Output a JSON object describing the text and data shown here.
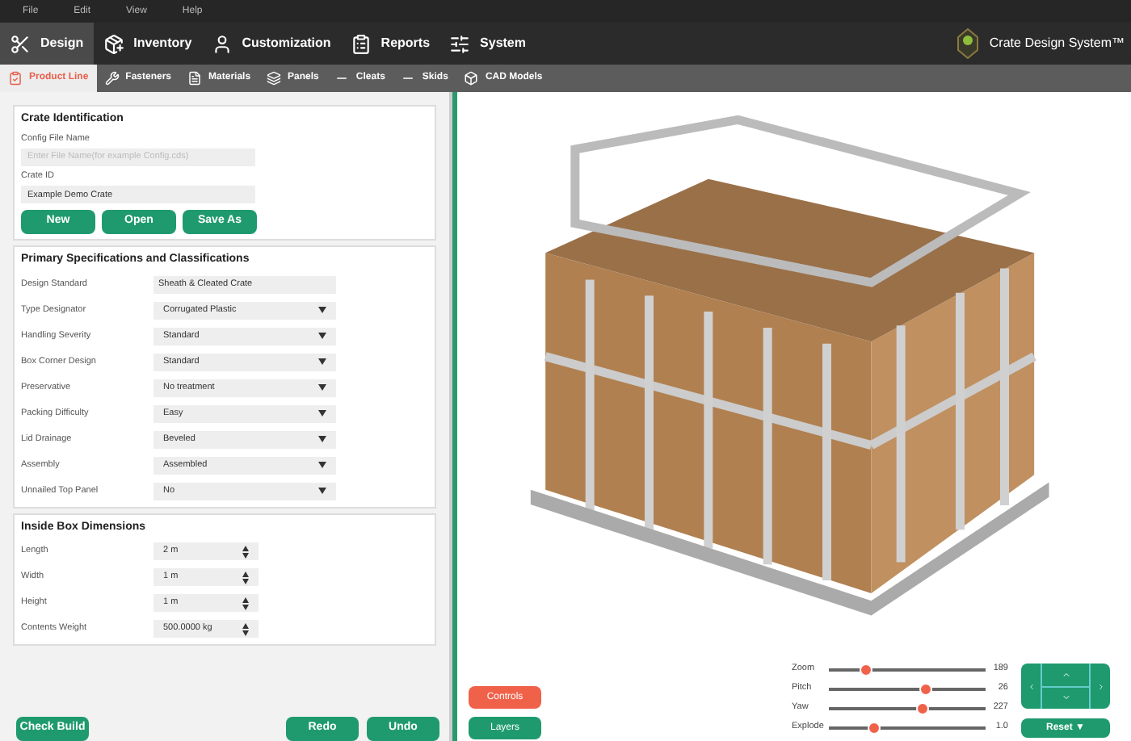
{
  "menu": [
    "File",
    "Edit",
    "View",
    "Help"
  ],
  "tabs": [
    {
      "label": "Design",
      "selected": true
    },
    {
      "label": "Inventory",
      "selected": false
    },
    {
      "label": "Customization",
      "selected": false
    },
    {
      "label": "Reports",
      "selected": false
    },
    {
      "label": "System",
      "selected": false
    }
  ],
  "brand": "Crate Design System™",
  "subtabs": [
    {
      "label": "Product Line",
      "selected": true
    },
    {
      "label": "Fasteners",
      "selected": false
    },
    {
      "label": "Materials",
      "selected": false
    },
    {
      "label": "Panels",
      "selected": false
    },
    {
      "label": "Cleats",
      "selected": false
    },
    {
      "label": "Skids",
      "selected": false
    },
    {
      "label": "CAD Models",
      "selected": false
    }
  ],
  "identification": {
    "title": "Crate Identification",
    "config_label": "Config File Name",
    "config_placeholder": "Enter File Name(for example Config.cds)",
    "id_label": "Crate ID",
    "id_value": "Example Demo Crate",
    "buttons": [
      "New",
      "Open",
      "Save As"
    ]
  },
  "specs": {
    "title": "Primary Specifications and Classifications",
    "rows": [
      {
        "label": "Design Standard",
        "value": "Sheath & Cleated Crate",
        "kind": "text"
      },
      {
        "label": "Type Designator",
        "value": "Corrugated Plastic",
        "kind": "select"
      },
      {
        "label": "Handling Severity",
        "value": "Standard",
        "kind": "select"
      },
      {
        "label": "Box Corner Design",
        "value": "Standard",
        "kind": "select"
      },
      {
        "label": "Preservative",
        "value": "No treatment",
        "kind": "select"
      },
      {
        "label": "Packing Difficulty",
        "value": "Easy",
        "kind": "select"
      },
      {
        "label": "Lid Drainage",
        "value": "Beveled",
        "kind": "select"
      },
      {
        "label": "Assembly",
        "value": "Assembled",
        "kind": "select"
      },
      {
        "label": "Unnailed Top Panel",
        "value": "No",
        "kind": "select"
      }
    ]
  },
  "dimensions": {
    "title": "Inside Box Dimensions",
    "rows": [
      {
        "label": "Length",
        "value": "2 m"
      },
      {
        "label": "Width",
        "value": "1 m"
      },
      {
        "label": "Height",
        "value": "1 m"
      },
      {
        "label": "Contents Weight",
        "value": "500.0000 kg"
      }
    ]
  },
  "footer_buttons": {
    "left": "Check Build",
    "right": [
      "Redo",
      "Undo"
    ]
  },
  "view_buttons": [
    {
      "label": "Controls",
      "kind": "accent"
    },
    {
      "label": "Layers",
      "kind": "primary"
    }
  ],
  "sliders": [
    {
      "label": "Zoom",
      "value": "189",
      "level": 0.24
    },
    {
      "label": "Pitch",
      "value": "26",
      "level": 0.62
    },
    {
      "label": "Yaw",
      "value": "227",
      "level": 0.6
    },
    {
      "label": "Explode",
      "value": "1.0",
      "level": 0.29
    }
  ],
  "reset": "Reset ▼"
}
